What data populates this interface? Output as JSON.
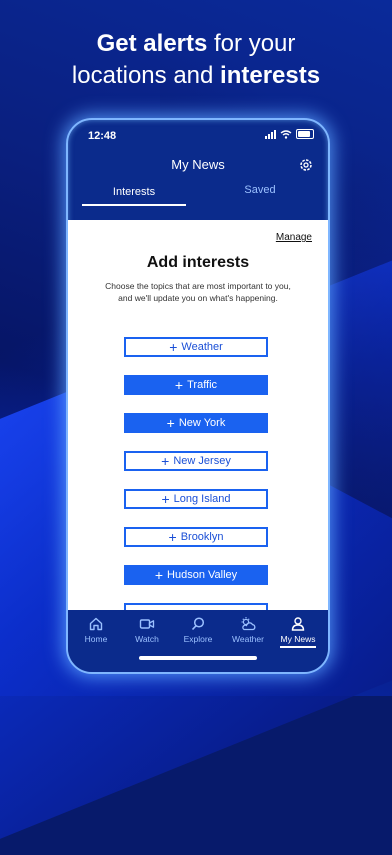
{
  "headline": {
    "part1": "Get alerts",
    "part2": " for your",
    "part3": "locations and ",
    "part4": "interests"
  },
  "status": {
    "time": "12:48"
  },
  "header": {
    "title": "My News"
  },
  "tabs": [
    {
      "label": "Interests",
      "active": true
    },
    {
      "label": "Saved",
      "active": false
    }
  ],
  "content": {
    "manage": "Manage",
    "title": "Add interests",
    "description": "Choose the topics that are most important to you, and we'll update you on what's happening."
  },
  "interests": [
    {
      "label": "Weather",
      "selected": false
    },
    {
      "label": "Traffic",
      "selected": true
    },
    {
      "label": "New York",
      "selected": true
    },
    {
      "label": "New Jersey",
      "selected": false
    },
    {
      "label": "Long Island",
      "selected": false
    },
    {
      "label": "Brooklyn",
      "selected": false
    },
    {
      "label": "Hudson Valley",
      "selected": true
    }
  ],
  "nav": [
    {
      "label": "Home",
      "icon": "home-icon"
    },
    {
      "label": "Watch",
      "icon": "video-icon"
    },
    {
      "label": "Explore",
      "icon": "search-icon"
    },
    {
      "label": "Weather",
      "icon": "weather-icon"
    },
    {
      "label": "My News",
      "icon": "person-icon",
      "active": true
    }
  ],
  "colors": {
    "accent": "#1a62f0",
    "navy": "#0b2b8c",
    "inactive": "#9bc0ff"
  }
}
